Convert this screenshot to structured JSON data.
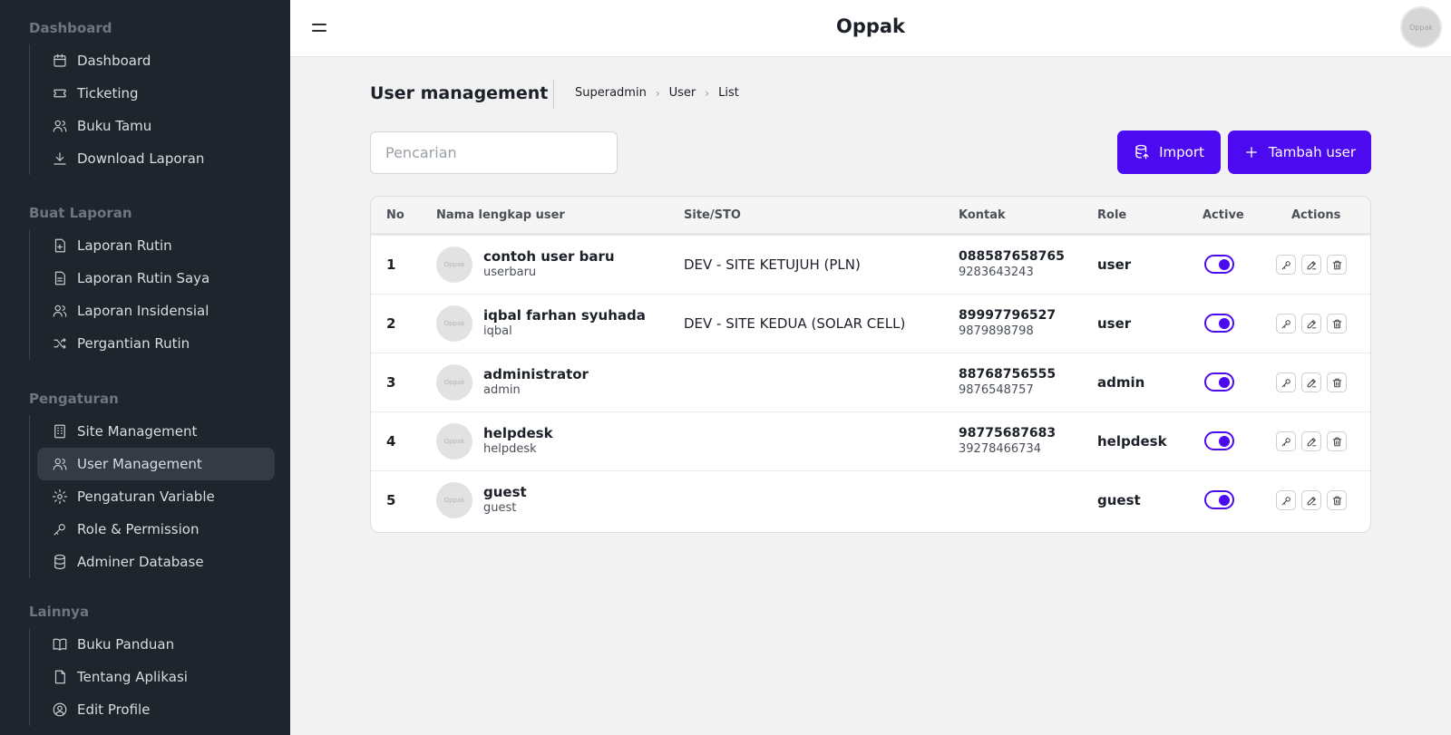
{
  "app": {
    "title": "Oppak",
    "avatar_text": "Oppak"
  },
  "sidebar": {
    "sections": [
      {
        "title": "Dashboard",
        "items": [
          {
            "label": "Dashboard",
            "icon": "calendar-icon"
          },
          {
            "label": "Ticketing",
            "icon": "ticket-icon"
          },
          {
            "label": "Buku Tamu",
            "icon": "users-icon"
          },
          {
            "label": "Download Laporan",
            "icon": "download-icon"
          }
        ]
      },
      {
        "title": "Buat Laporan",
        "items": [
          {
            "label": "Laporan Rutin",
            "icon": "file-plus-icon"
          },
          {
            "label": "Laporan Rutin Saya",
            "icon": "file-text-icon"
          },
          {
            "label": "Laporan Insidensial",
            "icon": "users-icon"
          },
          {
            "label": "Pergantian Rutin",
            "icon": "shuffle-icon"
          }
        ]
      },
      {
        "title": "Pengaturan",
        "items": [
          {
            "label": "Site Management",
            "icon": "building-icon"
          },
          {
            "label": "User Management",
            "icon": "users-icon",
            "active": true
          },
          {
            "label": "Pengaturan Variable",
            "icon": "gear-icon"
          },
          {
            "label": "Role & Permission",
            "icon": "key-icon"
          },
          {
            "label": "Adminer Database",
            "icon": "database-icon"
          }
        ]
      },
      {
        "title": "Lainnya",
        "items": [
          {
            "label": "Buku Panduan",
            "icon": "book-icon"
          },
          {
            "label": "Tentang Aplikasi",
            "icon": "file-icon"
          },
          {
            "label": "Edit Profile",
            "icon": "user-circle-icon"
          }
        ]
      }
    ]
  },
  "page": {
    "title": "User management",
    "breadcrumb": [
      "Superadmin",
      "User",
      "List"
    ]
  },
  "search": {
    "placeholder": "Pencarian",
    "value": ""
  },
  "buttons": {
    "import_label": "Import",
    "add_label": "Tambah user"
  },
  "table": {
    "headers": [
      "No",
      "Nama lengkap user",
      "Site/STO",
      "Kontak",
      "Role",
      "Active",
      "Actions"
    ],
    "rows": [
      {
        "no": "1",
        "name": "contoh user baru",
        "username": "userbaru",
        "site": "DEV - SITE KETUJUH (PLN)",
        "phone": "088587658765",
        "phone2": "9283643243",
        "role": "user",
        "active": true
      },
      {
        "no": "2",
        "name": "iqbal farhan syuhada",
        "username": "iqbal",
        "site": "DEV - SITE KEDUA (SOLAR CELL)",
        "phone": "89997796527",
        "phone2": "9879898798",
        "role": "user",
        "active": true
      },
      {
        "no": "3",
        "name": "administrator",
        "username": "admin",
        "site": "",
        "phone": "88768756555",
        "phone2": "9876548757",
        "role": "admin",
        "active": true
      },
      {
        "no": "4",
        "name": "helpdesk",
        "username": "helpdesk",
        "site": "",
        "phone": "98775687683",
        "phone2": "39278466734",
        "role": "helpdesk",
        "active": true
      },
      {
        "no": "5",
        "name": "guest",
        "username": "guest",
        "site": "",
        "phone": "",
        "phone2": "",
        "role": "guest",
        "active": true
      }
    ],
    "avatar_text": "Oppak"
  },
  "colors": {
    "accent": "#4c0af0",
    "sidebar_bg": "#1f252d",
    "page_bg": "#f2f2f2"
  }
}
